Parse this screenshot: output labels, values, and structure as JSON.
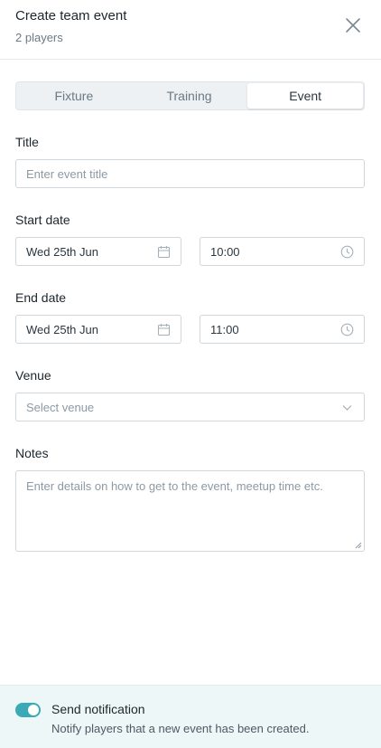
{
  "header": {
    "title": "Create team event",
    "subtitle": "2 players"
  },
  "tabs": [
    {
      "label": "Fixture",
      "active": false
    },
    {
      "label": "Training",
      "active": false
    },
    {
      "label": "Event",
      "active": true
    }
  ],
  "form": {
    "title_label": "Title",
    "title_placeholder": "Enter event title",
    "start_label": "Start date",
    "start_date": "Wed 25th Jun",
    "start_time": "10:00",
    "end_label": "End date",
    "end_date": "Wed 25th Jun",
    "end_time": "11:00",
    "venue_label": "Venue",
    "venue_placeholder": "Select venue",
    "notes_label": "Notes",
    "notes_placeholder": "Enter details on how to get to the event, meetup time etc."
  },
  "footer": {
    "notification_title": "Send notification",
    "notification_desc": "Notify players that a new event has been created.",
    "toggle_on": true
  },
  "icons": {
    "close": "close-icon",
    "calendar": "calendar-icon",
    "clock": "clock-icon",
    "chevron": "chevron-down-icon"
  },
  "colors": {
    "accent": "#3aaab6",
    "footer_bg": "#eef7f7"
  }
}
